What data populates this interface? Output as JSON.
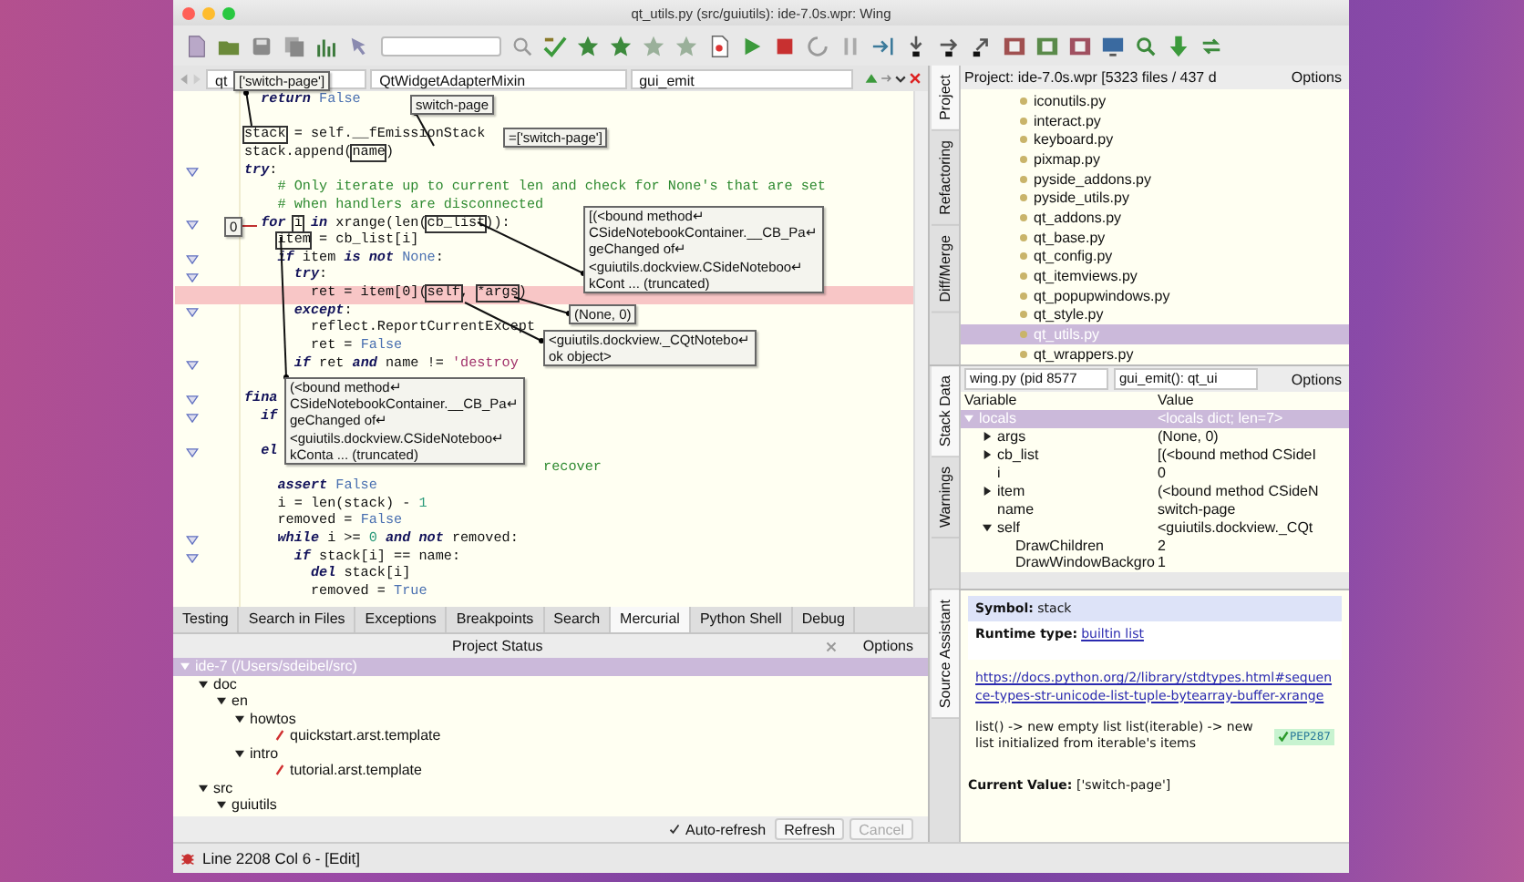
{
  "window": {
    "title": "qt_utils.py (src/guiutils): ide-7.0s.wpr: Wing"
  },
  "editor": {
    "nav": {
      "file": "qt",
      "class": "QtWidgetAdapterMixin",
      "method": "gui_emit"
    },
    "lines": [
      {
        "fold": false,
        "current": false,
        "tokens": [
          {
            "t": "  return",
            "kind": "kw"
          },
          {
            "t": " False",
            "kind": "const"
          }
        ]
      },
      {
        "fold": false,
        "current": false
      },
      {
        "fold": false,
        "current": false,
        "tokens": [
          {
            "t": "stack",
            "boxed": true
          },
          {
            "t": " = self.__fEmissionStack"
          }
        ]
      },
      {
        "fold": false,
        "current": false,
        "tokens": [
          {
            "t": "stack.append("
          },
          {
            "t": "name",
            "boxed": true
          },
          {
            "t": ")"
          }
        ]
      },
      {
        "fold": true,
        "current": false,
        "tokens": [
          {
            "t": "try",
            "kind": "kw"
          },
          {
            "t": ":"
          }
        ]
      },
      {
        "fold": false,
        "current": false,
        "tokens": [
          {
            "t": "    # Only iterate up to current len and check for None's that are set",
            "kind": "comment"
          }
        ]
      },
      {
        "fold": false,
        "current": false,
        "tokens": [
          {
            "t": "    # when handlers are disconnected",
            "kind": "comment"
          }
        ]
      },
      {
        "fold": true,
        "current": false,
        "tokens": [
          {
            "t": "  for ",
            "kind": "kw"
          },
          {
            "t": "i",
            "boxed": true
          },
          {
            "t": " in",
            "kind": "kw"
          },
          {
            "t": " xrange(len("
          },
          {
            "t": "cb_list",
            "boxed": true
          },
          {
            "t": ")):"
          }
        ]
      },
      {
        "fold": false,
        "current": false,
        "tokens": [
          {
            "t": "    item",
            "boxed": true
          },
          {
            "t": " = cb_list[i]"
          }
        ]
      },
      {
        "fold": true,
        "current": false,
        "tokens": [
          {
            "t": "    if",
            "kind": "kw"
          },
          {
            "t": " item "
          },
          {
            "t": "is not",
            "kind": "kw"
          },
          {
            "t": " None",
            "kind": "const"
          },
          {
            "t": ":"
          }
        ]
      },
      {
        "fold": true,
        "current": false,
        "tokens": [
          {
            "t": "      try",
            "kind": "kw"
          },
          {
            "t": ":"
          }
        ]
      },
      {
        "fold": false,
        "current": true,
        "tokens": [
          {
            "t": "        ret = item[0]("
          },
          {
            "t": "self",
            "boxed": true
          },
          {
            "t": ", "
          },
          {
            "t": "*args",
            "boxed": true
          },
          {
            "t": ")"
          }
        ]
      },
      {
        "fold": true,
        "current": false,
        "tokens": [
          {
            "t": "      except",
            "kind": "kw"
          },
          {
            "t": ":"
          }
        ]
      },
      {
        "fold": false,
        "current": false,
        "tokens": [
          {
            "t": "        reflect.ReportCurrentExcept"
          }
        ]
      },
      {
        "fold": false,
        "current": false,
        "tokens": [
          {
            "t": "        ret = "
          },
          {
            "t": "False",
            "kind": "const"
          }
        ]
      },
      {
        "fold": true,
        "current": false,
        "tokens": [
          {
            "t": "      if",
            "kind": "kw"
          },
          {
            "t": " ret "
          },
          {
            "t": "and",
            "kind": "kw"
          },
          {
            "t": " name != "
          },
          {
            "t": "'destroy",
            "kind": "str"
          }
        ]
      },
      {
        "fold": false,
        "current": false
      },
      {
        "fold": true,
        "current": false,
        "tokens": [
          {
            "t": "fina",
            "kind": "kw"
          }
        ]
      },
      {
        "fold": true,
        "current": false,
        "tokens": [
          {
            "t": "  if",
            "kind": "kw"
          }
        ]
      },
      {
        "fold": false,
        "current": false
      },
      {
        "fold": true,
        "current": false,
        "tokens": [
          {
            "t": "  el",
            "kind": "kw"
          }
        ]
      },
      {
        "fold": false,
        "current": false,
        "tokens": [
          {
            "t": "                                    recover",
            "kind": "comment"
          }
        ]
      },
      {
        "fold": false,
        "current": false,
        "tokens": [
          {
            "t": "    assert",
            "kind": "kw"
          },
          {
            "t": " False",
            "kind": "const"
          }
        ]
      },
      {
        "fold": false,
        "current": false,
        "tokens": [
          {
            "t": "    i = len(stack) - "
          },
          {
            "t": "1",
            "kind": "num"
          }
        ]
      },
      {
        "fold": false,
        "current": false,
        "tokens": [
          {
            "t": "    removed = "
          },
          {
            "t": "False",
            "kind": "const"
          }
        ]
      },
      {
        "fold": true,
        "current": false,
        "tokens": [
          {
            "t": "    while",
            "kind": "kw"
          },
          {
            "t": " i >= "
          },
          {
            "t": "0",
            "kind": "num"
          },
          {
            "t": " and not",
            "kind": "kw"
          },
          {
            "t": " removed:"
          }
        ]
      },
      {
        "fold": true,
        "current": false,
        "tokens": [
          {
            "t": "      if",
            "kind": "kw"
          },
          {
            "t": " stack[i] == name:"
          }
        ]
      },
      {
        "fold": false,
        "current": false,
        "tokens": [
          {
            "t": "        del",
            "kind": "kw"
          },
          {
            "t": " stack[i]"
          }
        ]
      },
      {
        "fold": false,
        "current": false,
        "tokens": [
          {
            "t": "        removed = "
          },
          {
            "t": "True",
            "kind": "const"
          }
        ]
      }
    ],
    "value_tips": [
      {
        "lines": [
          "['switch-page']"
        ]
      },
      {
        "lines": [
          "switch-page"
        ]
      },
      {
        "lines": [
          "=['switch-page']"
        ]
      },
      {
        "lines": [
          "0"
        ]
      },
      {
        "lines": [
          "[(<bound method↵",
          "CSideNotebookContainer.__CB_Pa↵",
          "geChanged of↵",
          "<guiutils.dockview.CSideNoteboo↵",
          "kCont ... (truncated)"
        ]
      },
      {
        "lines": [
          "(None, 0)"
        ]
      },
      {
        "lines": [
          "<guiutils.dockview._CQtNotebo↵",
          "ok object>"
        ]
      },
      {
        "lines": [
          "(<bound method↵",
          "CSideNotebookContainer.__CB_Pa↵",
          "geChanged of↵",
          "<guiutils.dockview.CSideNoteboo↵",
          "kConta ... (truncated)"
        ]
      }
    ]
  },
  "project": {
    "tabs": [
      {
        "label": "Project",
        "selected": true
      },
      {
        "label": "Refactoring",
        "selected": false
      },
      {
        "label": "Diff/Merge",
        "selected": false
      }
    ],
    "header": "Project: ide-7.0s.wpr [5323 files / 437 d",
    "options": "Options",
    "files": [
      {
        "name": "iconutils.py",
        "selected": false
      },
      {
        "name": "interact.py",
        "selected": false
      },
      {
        "name": "keyboard.py",
        "selected": false
      },
      {
        "name": "pixmap.py",
        "selected": false
      },
      {
        "name": "pyside_addons.py",
        "selected": false
      },
      {
        "name": "pyside_utils.py",
        "selected": false
      },
      {
        "name": "qt_addons.py",
        "selected": false
      },
      {
        "name": "qt_base.py",
        "selected": false
      },
      {
        "name": "qt_config.py",
        "selected": false
      },
      {
        "name": "qt_itemviews.py",
        "selected": false
      },
      {
        "name": "qt_popupwindows.py",
        "selected": false
      },
      {
        "name": "qt_style.py",
        "selected": false
      },
      {
        "name": "qt_utils.py",
        "selected": true
      },
      {
        "name": "qt_wrappers.py",
        "selected": false
      }
    ]
  },
  "stack": {
    "tabs": [
      {
        "label": "Stack Data",
        "selected": true
      },
      {
        "label": "Warnings",
        "selected": false
      }
    ],
    "process": "wing.py (pid 8577",
    "frame": "gui_emit(): qt_ui",
    "options": "Options",
    "columns": [
      "Variable",
      "Value"
    ],
    "rows": [
      {
        "name": "locals",
        "value": "<locals dict; len=7>",
        "selected": true,
        "expanded": true,
        "children": [
          {
            "name": "args",
            "value": "(None, 0)",
            "selected": false,
            "expanded": false
          },
          {
            "name": "cb_list",
            "value": "[(<bound method CSideI",
            "selected": false,
            "expanded": false
          },
          {
            "name": "i",
            "value": "0",
            "selected": false
          },
          {
            "name": "item",
            "value": "(<bound method CSideN",
            "selected": false,
            "expanded": false
          },
          {
            "name": "name",
            "value": "switch-page",
            "selected": false
          },
          {
            "name": "self",
            "value": "<guiutils.dockview._CQt",
            "selected": false,
            "expanded": true,
            "children": [
              {
                "name": "DrawChildren",
                "value": "2",
                "selected": false
              },
              {
                "name": "DrawWindowBackgro",
                "value": "1",
                "selected": false
              }
            ]
          }
        ]
      }
    ]
  },
  "assistant": {
    "tabs": [
      {
        "label": "Source Assistant",
        "selected": true
      }
    ],
    "symbol": "**Symbol:** stack",
    "runtime_label": "Runtime type:",
    "runtime_link": "builtin list",
    "url": "https://docs.python.org/2/library/stdtypes.html#sequence-types-str-unicode-list-tuple-bytearray-buffer-xrange",
    "doc": "list() -> new empty list list(iterable) -> new list initialized from iterable's items",
    "badge": "PEP287",
    "current": "**Current Value:** ['switch-page']"
  },
  "bottom": {
    "tabs": [
      {
        "label": "Testing",
        "selected": false
      },
      {
        "label": "Search in Files",
        "selected": false
      },
      {
        "label": "Exceptions",
        "selected": false
      },
      {
        "label": "Breakpoints",
        "selected": false
      },
      {
        "label": "Search",
        "selected": false
      },
      {
        "label": "Mercurial",
        "selected": true
      },
      {
        "label": "Python Shell",
        "selected": false
      },
      {
        "label": "Debug",
        "selected": false
      }
    ],
    "view": "Project Status",
    "options": "Options",
    "tree": [
      {
        "name": "ide-7 (/Users/sdeibel/src)",
        "selected": true,
        "expanded": true,
        "children": [
          {
            "name": "doc",
            "selected": false,
            "expanded": true,
            "children": [
              {
                "name": "en",
                "selected": false,
                "expanded": true,
                "children": [
                  {
                    "name": "howtos",
                    "selected": false,
                    "expanded": true,
                    "children": [
                      {
                        "name": "quickstart.arst.template",
                        "selected": false
                      }
                    ]
                  },
                  {
                    "name": "intro",
                    "selected": false,
                    "expanded": true,
                    "children": [
                      {
                        "name": "tutorial.arst.template",
                        "selected": false
                      }
                    ]
                  }
                ]
              }
            ]
          },
          {
            "name": "src",
            "selected": false,
            "expanded": true,
            "children": [
              {
                "name": "guiutils",
                "selected": false,
                "expanded": true
              }
            ]
          }
        ]
      }
    ],
    "auto_refresh": {
      "label": "Auto-refresh",
      "checked": true
    },
    "buttons": [
      {
        "label": "Refresh",
        "disabled": false
      },
      {
        "label": "Cancel",
        "disabled": true
      }
    ]
  },
  "status_bar": {
    "text": "Line 2208 Col 6 - [Edit]"
  }
}
